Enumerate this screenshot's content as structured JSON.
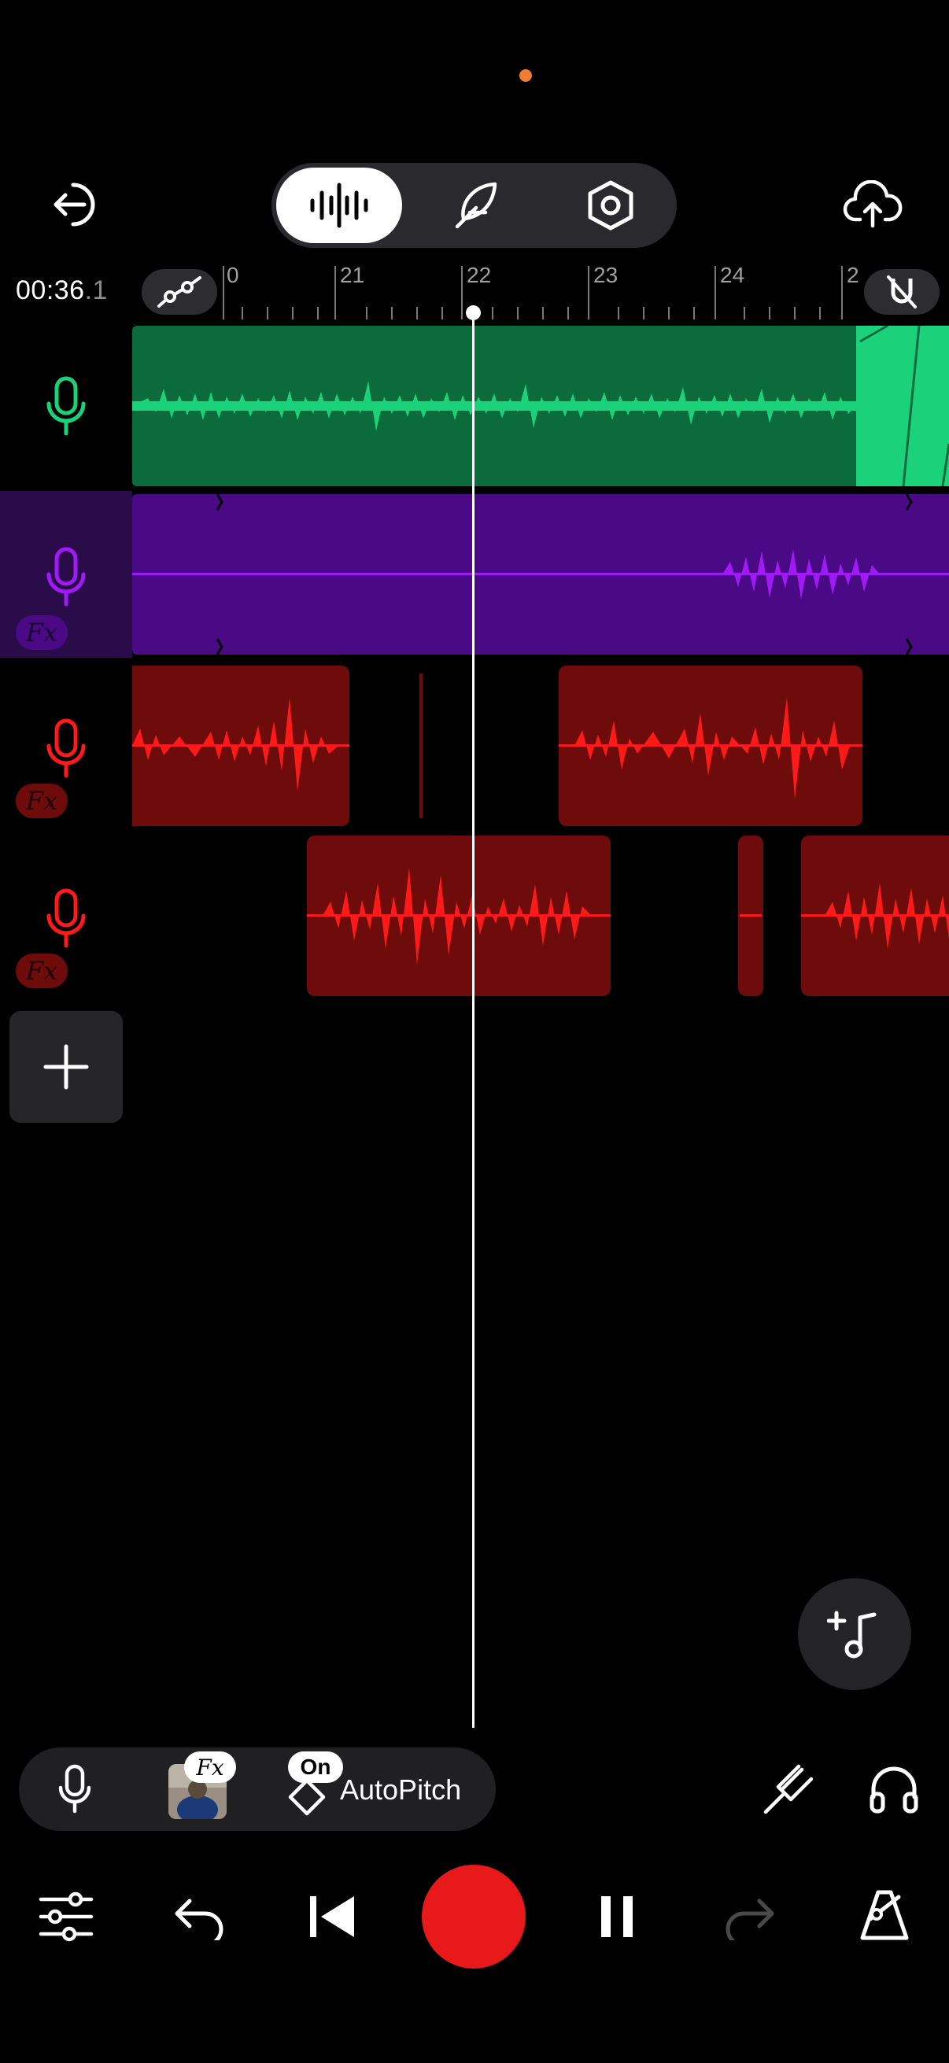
{
  "topbar": {
    "exit_icon": "exit-icon",
    "modes": [
      {
        "name": "waveform-mode",
        "icon": "waveform-icon",
        "active": true
      },
      {
        "name": "pen-mode",
        "icon": "feather-icon",
        "active": false
      },
      {
        "name": "settings-mode",
        "icon": "hex-nut-icon",
        "active": false
      }
    ],
    "upload_icon": "cloud-upload-icon"
  },
  "ruler": {
    "time_main": "00:36",
    "time_frac": ".1",
    "ticks": [
      "0",
      "21",
      "22",
      "23",
      "24",
      "2"
    ]
  },
  "tracks": [
    {
      "name": "track-1",
      "color": "#1bd17a",
      "clip_bg": "#0b6b3a",
      "fx": false
    },
    {
      "name": "track-2",
      "color": "#a11af5",
      "clip_bg": "#4a0a86",
      "fx": true,
      "fx_label": "Fx"
    },
    {
      "name": "track-3",
      "color": "#ff1a1a",
      "clip_bg": "#6e0b0b",
      "fx": true,
      "fx_label": "Fx"
    },
    {
      "name": "track-4",
      "color": "#ff1a1a",
      "clip_bg": "#6e0b0b",
      "fx": true,
      "fx_label": "Fx"
    }
  ],
  "fxbar": {
    "fx_label": "Fx",
    "on_label": "On",
    "autopitch_label": "AutoPitch"
  },
  "colors": {
    "accent_record": "#e8191a",
    "dot": "#f07d32"
  }
}
